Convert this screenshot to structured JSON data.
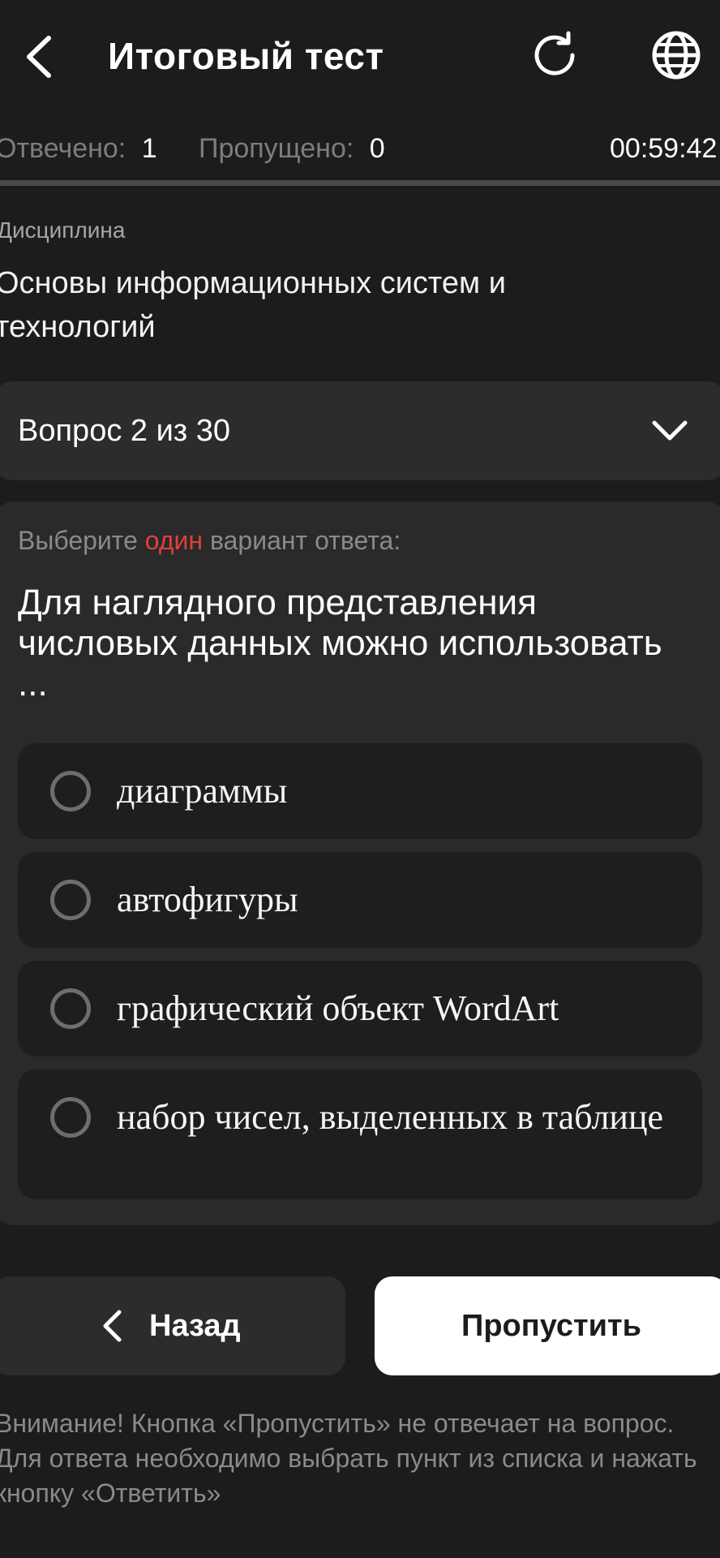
{
  "header": {
    "title": "Итоговый тест",
    "icons": [
      "back-arrow-icon",
      "refresh-icon",
      "globe-icon"
    ]
  },
  "stats": {
    "answered_label": "Отвечено:",
    "answered_value": "1",
    "skipped_label": "Пропущено:",
    "skipped_value": "0",
    "timer": "00:59:42"
  },
  "discipline": {
    "label": "Дисциплина",
    "name": "Основы информационных систем и технологий"
  },
  "question_selector": {
    "label": "Вопрос 2 из 30"
  },
  "question": {
    "instruction_prefix": "Выберите ",
    "instruction_accent": "один",
    "instruction_suffix": " вариант ответа:",
    "text": "Для наглядного представления числовых данных можно использовать ...",
    "options": [
      {
        "label": "диаграммы",
        "selected": false
      },
      {
        "label": "автофигуры",
        "selected": false
      },
      {
        "label": "графический объект WordArt",
        "selected": false
      },
      {
        "label": "набор чисел, выделенных в таблице",
        "selected": false
      }
    ]
  },
  "buttons": {
    "back_label": "Назад",
    "skip_label": "Пропустить"
  },
  "notice": "Внимание! Кнопка «Пропустить» не отвечает на вопрос. Для ответа необходимо выбрать пункт из списка и нажать кнопку «Ответить»",
  "colors": {
    "background": "#1c1c1c",
    "card": "#2a2a2a",
    "accent": "#e0403a",
    "primary_button": "#ffffff"
  }
}
